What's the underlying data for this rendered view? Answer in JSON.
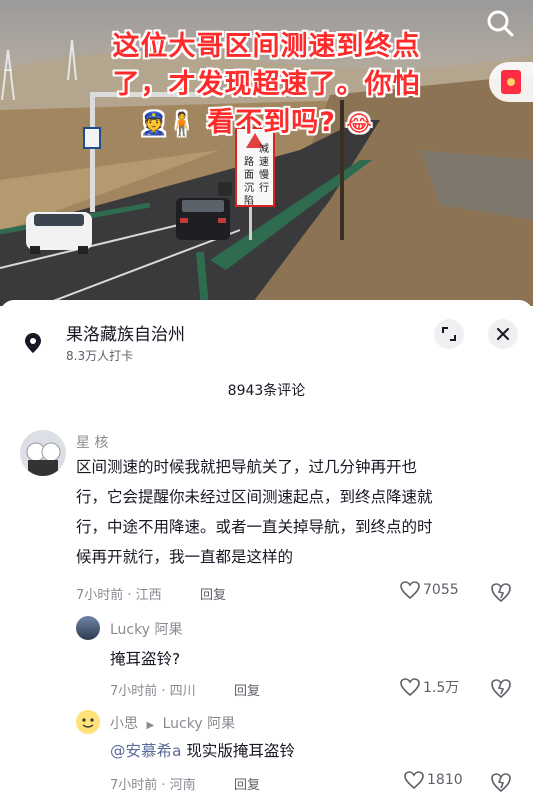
{
  "video": {
    "caption_line1": "这位大哥区间测速到终点",
    "caption_line2": "了，才发现超速了。你怕",
    "caption_line3": "看不到吗?",
    "caption_emojis": "👮🧍",
    "caption_end_emoji": "😂",
    "road_sign_col1": "路面沉陷",
    "road_sign_col2": "减速慢行"
  },
  "location": {
    "title": "果洛藏族自治州",
    "checkins": "8.3万人打卡"
  },
  "comments_count": "8943条评论",
  "comments": [
    {
      "user": "星 核",
      "text_lines": [
        "区间测速的时候我就把导航关了，过几分钟再开也",
        "行，它会提醒你未经过区间测速起点，到终点降速就",
        "行，中途不用降速。或者一直关掉导航，到终点的时",
        "候再开就行，我一直都是这样的"
      ],
      "meta": "7小时前 · 江西",
      "reply_label": "回复",
      "likes": "7055"
    },
    {
      "user": "Lucky 阿果",
      "text": "掩耳盗铃?",
      "meta": "7小时前 · 四川",
      "reply_label": "回复",
      "likes": "1.5万"
    },
    {
      "user": "小思",
      "reply_to": "Lucky 阿果",
      "mention": "@安慕希a",
      "text": " 现实版掩耳盗铃",
      "meta": "7小时前 · 河南",
      "reply_label": "回复",
      "likes": "1810"
    }
  ]
}
